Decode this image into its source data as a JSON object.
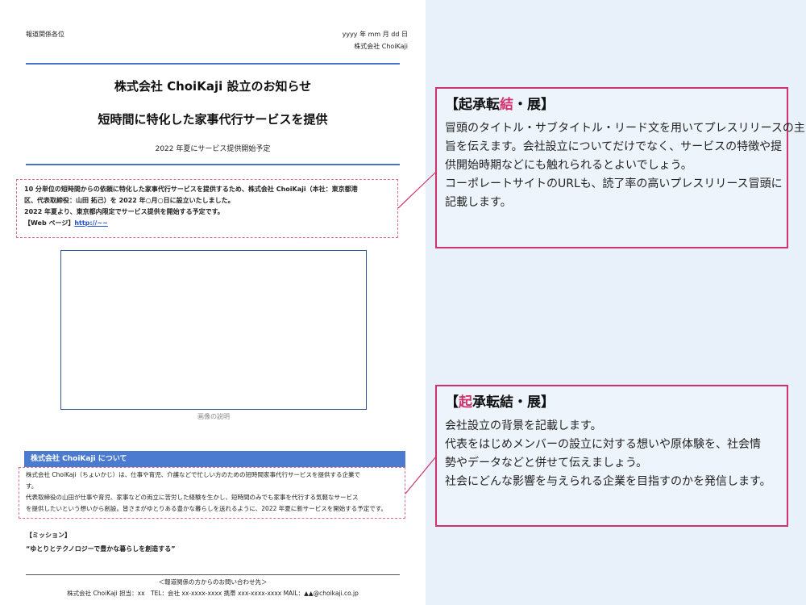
{
  "document": {
    "recipient": "報道関係各位",
    "date": "yyyy 年 mm 月 dd 日",
    "company": "株式会社 ChoiKaji",
    "title": "株式会社 ChoiKaji 設立のお知らせ",
    "subtitle": "短時間に特化した家事代行サービスを提供",
    "tagline": "2022 年夏にサービス提供開始予定",
    "lead": {
      "line1": "10 分単位の短時間からの依頼に特化した家事代行サービスを提供するため、株式会社 ChoiKaji（本社：東京都港",
      "line2": "区、代表取締役：山田 拓己）を 2022 年○月○日に設立いたしました。",
      "line3": "2022 年夏より、東京都内限定でサービス提供を開始する予定です。",
      "web_label": "【Web ページ】",
      "web_url": "http://~~"
    },
    "image_caption": "画像の説明",
    "about": {
      "header": "株式会社 ChoiKaji について",
      "line1": "株式会社 ChoiKaji（ちょいかじ）は、仕事や育児、介護などで忙しい方のための短時間家事代行サービスを提供する企業で",
      "line2": "す。",
      "line3": "代表取締役の山田が仕事や育児、家事などの両立に苦労した経験を生かし、短時間のみでも家事を代行する気軽なサービス",
      "line4": "を提供したいという想いから創設。皆さまがゆとりある豊かな暮らしを送れるように、2022 年夏に新サービスを開始する予定です。"
    },
    "mission_label": "【ミッション】",
    "mission_text": "“ゆとりとテクノロジーで豊かな暮らしを創造する”",
    "footer_heading": "＜報道関係の方からのお問い合わせ先＞",
    "footer_contact": "株式会社 ChoiKaji 担当：xx　TEL：会社 xx-xxxx-xxxx 携帯 xxx-xxxx-xxxx MAIL：▲▲@choikaji.co.jp"
  },
  "callouts": [
    {
      "title_before": "【起承転",
      "title_highlight": "結",
      "title_after": "・展】",
      "lines": [
        "冒頭のタイトル・サブタイトル・リード文を用いてプレスリリースの主",
        "旨を伝えます。会社設立についてだけでなく、サービスの特徴や提",
        "供開始時期などにも触れられるとよいでしょう。",
        "コーポレートサイトのURLも、読了率の高いプレスリリース冒頭に",
        "記載します。"
      ]
    },
    {
      "title_before": "【",
      "title_highlight": "起",
      "title_after": "承転結・展】",
      "lines": [
        "会社設立の背景を記載します。",
        "代表をはじめメンバーの設立に対する想いや原体験を、社会情",
        "勢やデータなどと併せて伝えましょう。",
        "社会にどんな影響を与えられる企業を目指すのかを発信します。"
      ]
    }
  ],
  "colors": {
    "accent_pink": "#d2316e",
    "accent_blue": "#4a74c8",
    "panel_background": "#e8f1fa"
  }
}
